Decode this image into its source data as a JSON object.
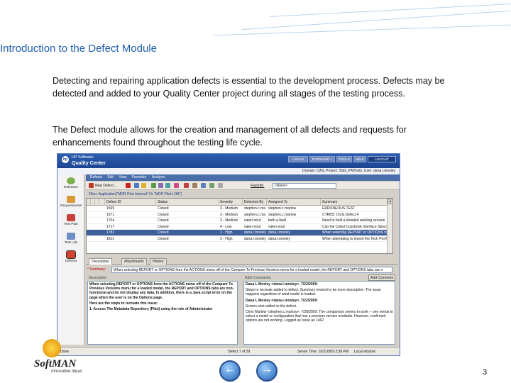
{
  "slide": {
    "title": "Introduction to the Defect Module",
    "paragraph1": "Detecting and repairing application defects is essential to the development process. Defects may be detected and added to your Quality Center project during all stages of the testing process.",
    "paragraph2": "The Defect module allows for the creation and management of all defects and requests for enhancements found throughout the testing life cycle.",
    "page_number": "3",
    "logo_text": "SoftMAN",
    "logo_tagline": "Innovative Ideas"
  },
  "app": {
    "brand": "HP Software",
    "product": "Quality Center",
    "nav_buttons": [
      "< BACK",
      "FORWARD >",
      "TOOLS",
      "HELP",
      "LOGOUT"
    ],
    "context": "Domain: CAS, Project: SSG_PMTools, User: dana.l.mosley",
    "menu": [
      "Defects",
      "Edit",
      "View",
      "Favorites",
      "Analysis"
    ],
    "toolbar": {
      "new_defect": "New Defect...",
      "favorites_label": "Favorite:",
      "favorites_value": "<None>"
    },
    "filter": "Filter: Application[\"MDR Pilot Internal\" Or \"MDR Pilot LOB\"]",
    "sidebar": [
      "Releases",
      "Requirements",
      "Test Plan",
      "Test Lab",
      "Defects"
    ],
    "columns": [
      "Defect ID",
      "Status",
      "Severity",
      "Detected By",
      "Assigned To",
      "Summary"
    ],
    "rows": [
      [
        "1569",
        "Closed",
        "3 - Medium",
        "stephen.c.ma",
        "stephen.c.marlow",
        "ERRONEOUS TEST"
      ],
      [
        "1571",
        "Closed",
        "3 - Medium",
        "stephen.c.ma",
        "stephen.c.marlow",
        "CTRBS: Chris Defect 4"
      ],
      [
        "1704",
        "Closed",
        "3 - Medium",
        "valeri.trout",
        "beth.a.fizell",
        "Need to hold a detailed working session"
      ],
      [
        "1717",
        "Closed",
        "4 - Low",
        "valeri.trout",
        "valeri.trout",
        "Can the Cobol Copybook Interface Specif"
      ],
      [
        "1782",
        "Closed",
        "2 - High",
        "dana.l.mosley",
        "dana.l.mosley",
        "When selecting REPORT or OPTIONS fro"
      ],
      [
        "1811",
        "Closed",
        "2 - High",
        "dana.l.mosley",
        "dana.l.mosley",
        "When attempting to import the Tech Portf"
      ]
    ],
    "tabs": [
      "Description",
      "Attachments",
      "History"
    ],
    "summary_label": "* Summary:",
    "summary_value": "When selecting REPORT or OPTIONS from the ACTIONS menu off of the Compare To Previous Versions menu for a loaded model, the REPORT and OPTIONS tabs are n",
    "add_comment": "Add Comment",
    "description_label": "Description:",
    "description": [
      "When selecting REPORT or OPTIONS from the ACTIONS menu off of the Compare To Previous Versions menu for a loaded model, the REPORT and OPTIONS tabs are non-functional and do not display any data. In addition, there is a Java script error on the page when the user is on the Options page.",
      "Here are the steps to recreate this issue:",
      "1. Access The Metadata Repository (Pilot) using the role of Administrator"
    ],
    "comments_label": "R&D Comments:",
    "comments": [
      "Dana L Mosley <dana.l.mosley>, 7/22/2009:",
      "Steps to recreate added to defect. Summary revised to be more descriptive. The issue happens regardless of what model is loaded.",
      "Dana L Mosley <dana.l.mosley>, 7/22/2009:",
      "Screen shot added to the defect.",
      "Chris Marlow <stephen.c.marlow>, 7/28/2009: The comparison seems to work -- one needs to select a model or configuration that has a previous version available. However, confirmed options are not working. Logged as issue as 1462"
    ],
    "status_done": "Done",
    "defect_count": "Defect 7 of 29",
    "server_time": "Server Time: 10/2/2009 2:36 PM",
    "zone": "Local intranet"
  },
  "colors": {
    "title": "#1f5fae",
    "header": "#1c4591",
    "selected_row": "#3d5f9c"
  }
}
